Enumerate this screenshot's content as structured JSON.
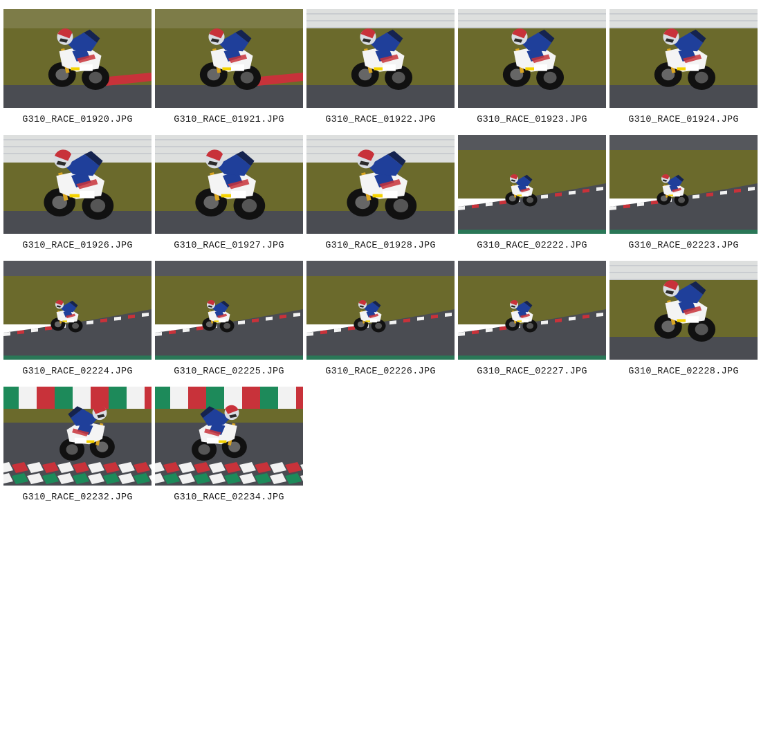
{
  "gallery": {
    "items": [
      {
        "filename": "G310_RACE_01920.JPG",
        "scene": "closeup-wall"
      },
      {
        "filename": "G310_RACE_01921.JPG",
        "scene": "closeup-wall"
      },
      {
        "filename": "G310_RACE_01922.JPG",
        "scene": "closeup-wall"
      },
      {
        "filename": "G310_RACE_01923.JPG",
        "scene": "closeup-wall"
      },
      {
        "filename": "G310_RACE_01924.JPG",
        "scene": "closeup-wall"
      },
      {
        "filename": "G310_RACE_01926.JPG",
        "scene": "closeup-wall-big"
      },
      {
        "filename": "G310_RACE_01927.JPG",
        "scene": "closeup-wall-big"
      },
      {
        "filename": "G310_RACE_01928.JPG",
        "scene": "closeup-wall-big"
      },
      {
        "filename": "G310_RACE_02222.JPG",
        "scene": "wide-curb"
      },
      {
        "filename": "G310_RACE_02223.JPG",
        "scene": "wide-curb"
      },
      {
        "filename": "G310_RACE_02224.JPG",
        "scene": "wide-curb"
      },
      {
        "filename": "G310_RACE_02225.JPG",
        "scene": "wide-curb"
      },
      {
        "filename": "G310_RACE_02226.JPG",
        "scene": "wide-curb"
      },
      {
        "filename": "G310_RACE_02227.JPG",
        "scene": "wide-curb"
      },
      {
        "filename": "G310_RACE_02228.JPG",
        "scene": "closeup-wall"
      },
      {
        "filename": "G310_RACE_02232.JPG",
        "scene": "flag-wall"
      },
      {
        "filename": "G310_RACE_02234.JPG",
        "scene": "flag-wall"
      }
    ]
  },
  "colors": {
    "grass": "#6b6a2c",
    "asphalt": "#3d3f44",
    "wall": "#e4e6e8",
    "curb_red": "#c8323a",
    "curb_white": "#f2f2f2",
    "flag_green": "#1d8a5a",
    "rider_blue": "#1f3f9a",
    "bike_white": "#f4f4f4",
    "tire": "#111111",
    "number_plate": "#f5d300"
  }
}
